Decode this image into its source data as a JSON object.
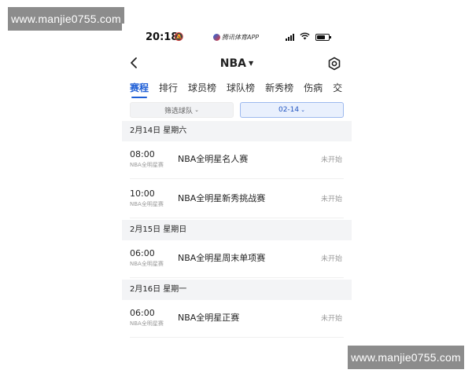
{
  "watermark": {
    "text": "www.manjie0755.com"
  },
  "status_bar": {
    "time": "20:18",
    "app_name": "腾讯体育APP",
    "battery_level": 0.7
  },
  "nav": {
    "title": "NBA",
    "back_icon": "back-arrow-icon",
    "settings_icon": "settings-icon"
  },
  "tabs": [
    {
      "label": "赛程",
      "active": true
    },
    {
      "label": "排行",
      "active": false
    },
    {
      "label": "球员榜",
      "active": false
    },
    {
      "label": "球队榜",
      "active": false
    },
    {
      "label": "新秀榜",
      "active": false
    },
    {
      "label": "伤病",
      "active": false
    },
    {
      "label": "交",
      "active": false
    }
  ],
  "filters": {
    "team_label": "筛选球队",
    "date_label": "02-14"
  },
  "days": [
    {
      "header": "2月14日  星期六",
      "games": [
        {
          "time": "08:00",
          "league": "NBA全明星赛",
          "name": "NBA全明星名人赛",
          "status": "未开始"
        },
        {
          "time": "10:00",
          "league": "NBA全明星赛",
          "name": "NBA全明星新秀挑战赛",
          "status": "未开始"
        }
      ]
    },
    {
      "header": "2月15日  星期日",
      "games": [
        {
          "time": "06:00",
          "league": "NBA全明星赛",
          "name": "NBA全明星周末单项赛",
          "status": "未开始"
        }
      ]
    },
    {
      "header": "2月16日  星期一",
      "games": [
        {
          "time": "06:00",
          "league": "NBA全明星赛",
          "name": "NBA全明星正赛",
          "status": "未开始"
        }
      ]
    }
  ],
  "colors": {
    "accent": "#1f5fd6",
    "section_bg": "#f3f4f6",
    "muted": "#999999"
  }
}
